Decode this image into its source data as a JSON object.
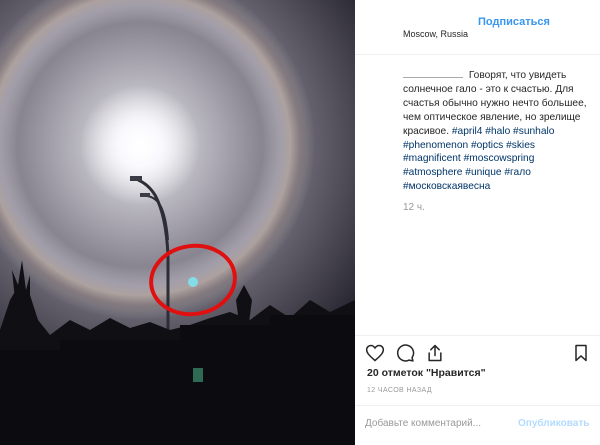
{
  "header": {
    "follow_label": "Подписаться",
    "location": "Moscow, Russia"
  },
  "caption": {
    "text": "Говорят, что увидеть солнечное гало - это к счастью. Для счастья обычно нужно нечто большее, чем оптическое явление, но зрелище красивое.",
    "tags": "#april4 #halo #sunhalo #phenomenon #optics #skies #magnificent #moscowspring #atmosphere #unique #гало #московскаявесна"
  },
  "time": "12 ч.",
  "likes": "20 отметок \"Нравится\"",
  "ago": "12 ЧАСОВ НАЗАД",
  "comment": {
    "placeholder": "Добавьте комментарий...",
    "publish_label": "Опубликовать"
  },
  "icons": [
    "heart-icon",
    "comment-icon",
    "share-icon",
    "bookmark-icon"
  ],
  "colors": {
    "link": "#3897f0",
    "tags": "#003569",
    "circle": "#e01010",
    "muted": "#999999"
  }
}
